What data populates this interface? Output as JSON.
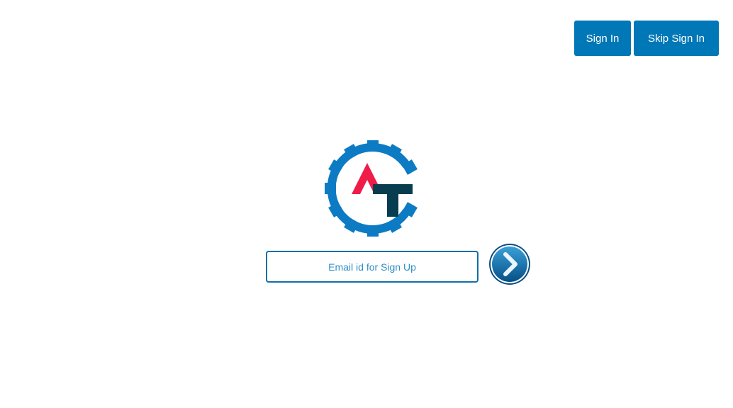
{
  "header": {
    "sign_in_label": "Sign In",
    "skip_sign_in_label": "Skip Sign In"
  },
  "signup": {
    "email_placeholder": "Email id for Sign Up",
    "email_value": "",
    "submit_icon": "chevron-right-icon"
  },
  "logo": {
    "icon": "gear-logo-icon"
  },
  "colors": {
    "primary": "#0077b6",
    "logo_gear": "#0d7bc4",
    "logo_red": "#ef1c4a",
    "logo_dark": "#083c4f"
  }
}
